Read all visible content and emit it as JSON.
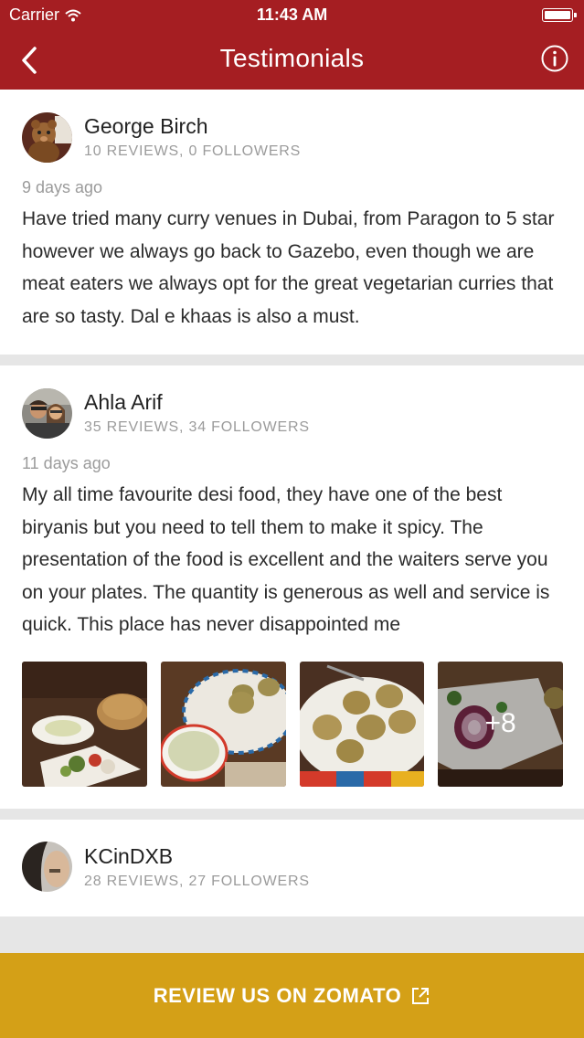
{
  "status_bar": {
    "carrier": "Carrier",
    "time": "11:43 AM"
  },
  "nav": {
    "title": "Testimonials"
  },
  "reviews": [
    {
      "name": "George Birch",
      "stats": "10 REVIEWS, 0 FOLLOWERS",
      "time": "9 days ago",
      "text": "Have tried many curry venues in Dubai, from Paragon to 5 star however we always go back to Gazebo, even though we are meat eaters we always opt for the great vegetarian curries that are so tasty. Dal e khaas is also a must."
    },
    {
      "name": "Ahla Arif",
      "stats": "35 REVIEWS, 34 FOLLOWERS",
      "time": "11 days ago",
      "text": "My all time favourite desi food, they have one of the best biryanis but you need to tell them to make it spicy. The presentation of the food is excellent and the waiters serve you on your plates. The quantity is generous as well and service is quick. This place has never disappointed me",
      "more_photos": "+8"
    },
    {
      "name": "KCinDXB",
      "stats": "28 REVIEWS, 27 FOLLOWERS"
    }
  ],
  "cta": {
    "label": "REVIEW US ON ZOMATO"
  },
  "colors": {
    "header": "#a51e22",
    "cta": "#d4a017"
  }
}
